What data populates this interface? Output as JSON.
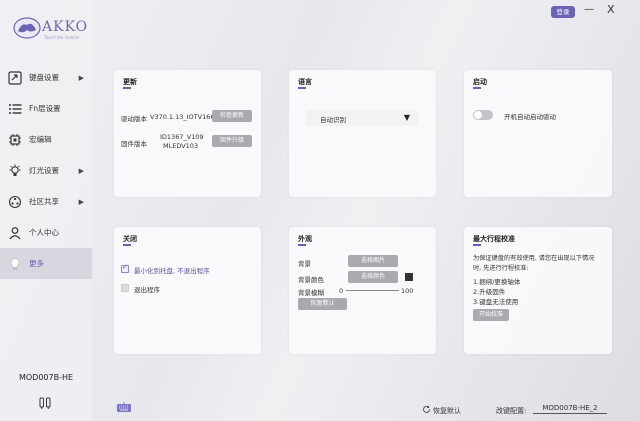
{
  "app": {
    "logo_text": "AKKO",
    "logo_sub": "Touch the fashion",
    "login_label": "登录",
    "minimize_label": "—",
    "close_label": "X"
  },
  "sidebar": {
    "items": [
      {
        "label": "键盘设置",
        "icon": "keyboard-icon",
        "has_arrow": true
      },
      {
        "label": "Fn层设置",
        "icon": "list-icon",
        "has_arrow": false
      },
      {
        "label": "宏编辑",
        "icon": "chip-icon",
        "has_arrow": false
      },
      {
        "label": "灯光设置",
        "icon": "bulb-icon",
        "has_arrow": true
      },
      {
        "label": "社区共享",
        "icon": "share-icon",
        "has_arrow": true
      },
      {
        "label": "个人中心",
        "icon": "person-icon",
        "has_arrow": false
      },
      {
        "label": "更多",
        "icon": "lightbulb-icon",
        "has_arrow": false,
        "active": true
      }
    ],
    "arrow": "▶",
    "device_name": "MOD007B-HE"
  },
  "cards": {
    "update": {
      "title": "更新",
      "driver_label": "驱动版本",
      "driver_value": "V370.1.13_IOTV166",
      "check_update": "检查更新",
      "firmware_label": "固件版本",
      "firmware_value_line1": "ID1367_V109",
      "firmware_value_line2": "MLEDV103",
      "firmware_upgrade": "固件升级"
    },
    "language": {
      "title": "语言",
      "selected": "自动识别",
      "caret": "▼"
    },
    "startup": {
      "title": "启动",
      "toggle_label": "开机自动启动驱动",
      "toggle_on": false
    },
    "close": {
      "title": "关闭",
      "option1": "最小化到托盘, 不退出程序",
      "option1_checked": true,
      "option2": "退出程序",
      "option2_checked": false
    },
    "appearance": {
      "title": "外观",
      "bg_label": "背景",
      "bg_button": "选择图片",
      "bg_color_label": "背景颜色",
      "bg_color_button": "选择颜色",
      "bg_color_swatch": "#333333",
      "blur_label": "背景模糊",
      "blur_min": "0",
      "blur_max": "100",
      "blur_value": 0,
      "reset_button": "恢复默认"
    },
    "calibration": {
      "title": "最大行程校准",
      "desc_line1": "为保证键盘的有效使用, 请您在出现以下情况",
      "desc_line2": "时, 先进行行程校准:",
      "item1": "1.捆绑/更换轴体",
      "item2": "2.升级固件",
      "item3": "3.键盘无法使用",
      "start_button": "开始校准"
    }
  },
  "footer": {
    "restore_label": "恢复默认",
    "change_config_label": "改键配置:",
    "change_config_value": "MOD007B-HE_2"
  },
  "colors": {
    "accent": "#6a62b8",
    "button_gray": "#a9a9ae"
  }
}
